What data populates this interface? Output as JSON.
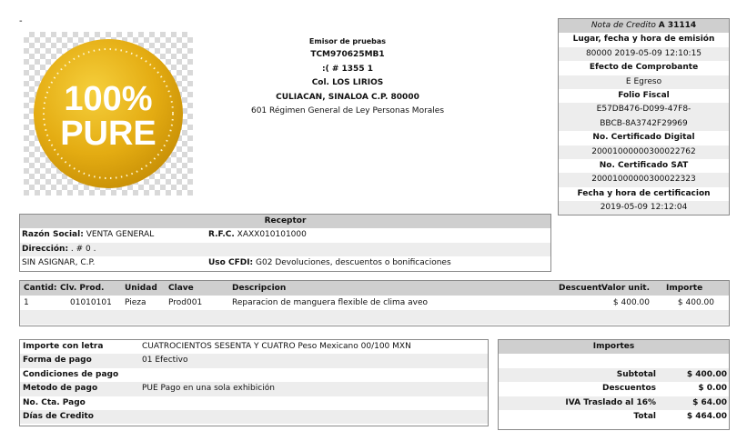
{
  "dash": "-",
  "logo": {
    "line1": "100%",
    "line2": "PURE",
    "color": "#e9b71f"
  },
  "emisor": {
    "title": "Emisor de pruebas",
    "rfc": "TCM970625MB1",
    "number": ":( # 1355 1",
    "colonia": "Col. LOS LIRIOS",
    "city": "CULIACAN, SINALOA C.P. 80000",
    "regimen": "601 Régimen General de Ley Personas Morales"
  },
  "header": {
    "doc_type": "Nota de Credito",
    "doc_number": "A 31114",
    "lugar_label": "Lugar, fecha y hora de emisión",
    "lugar_value": "80000 2019-05-09 12:10:15",
    "efecto_label": "Efecto de Comprobante",
    "efecto_value": "E Egreso",
    "folio_label": "Folio Fiscal",
    "folio_value_1": "E57DB476-D099-47F8-",
    "folio_value_2": "BBCB-8A3742F29969",
    "cert_label": "No. Certificado Digital",
    "cert_value": "20001000000300022762",
    "cert_sat_label": "No. Certificado SAT",
    "cert_sat_value": "20001000000300022323",
    "fecha_cert_label": "Fecha y hora de certificacion",
    "fecha_cert_value": "2019-05-09 12:12:04"
  },
  "receptor": {
    "title": "Receptor",
    "razon_label": "Razón Social:",
    "razon_value": "VENTA GENERAL",
    "rfc_label": "R.F.C.",
    "rfc_value": "XAXX010101000",
    "direccion_label": "Dirección:",
    "direccion_value": ". # 0 .",
    "address_line": "SIN ASIGNAR, C.P.",
    "uso_label": "Uso CFDI:",
    "uso_value": "G02 Devoluciones, descuentos o bonificaciones"
  },
  "items": {
    "headers": {
      "cantidad": "Cantid:",
      "clv_prod": "Clv. Prod.",
      "unidad": "Unidad",
      "clave": "Clave",
      "descripcion": "Descripcion",
      "descuento": "Descuent",
      "valor_unit": "Valor unit.",
      "importe": "Importe"
    },
    "rows": [
      {
        "cantidad": "1",
        "clv_prod": "01010101",
        "unidad": "Pieza",
        "clave": "Prod001",
        "descripcion": "Reparacion de manguera flexible de clima aveo",
        "valor_unit": "$ 400.00",
        "importe": "$ 400.00"
      }
    ]
  },
  "payment": {
    "importe_letra_label": "Importe con letra",
    "importe_letra_value": "CUATROCIENTOS SESENTA Y CUATRO Peso Mexicano 00/100 MXN",
    "forma_label": "Forma de pago",
    "forma_value": "01 Efectivo",
    "condiciones_label": "Condiciones de pago",
    "condiciones_value": "",
    "metodo_label": "Metodo de pago",
    "metodo_value": "PUE Pago en una sola exhibición",
    "cuenta_label": "No. Cta. Pago",
    "cuenta_value": "",
    "dias_label": "Días de Credito",
    "dias_value": ""
  },
  "totals": {
    "title": "Importes",
    "subtotal_label": "Subtotal",
    "subtotal_value": "$ 400.00",
    "descuentos_label": "Descuentos",
    "descuentos_value": "$ 0.00",
    "iva_label": "IVA Traslado al 16%",
    "iva_value": "$ 64.00",
    "total_label": "Total",
    "total_value": "$ 464.00"
  }
}
